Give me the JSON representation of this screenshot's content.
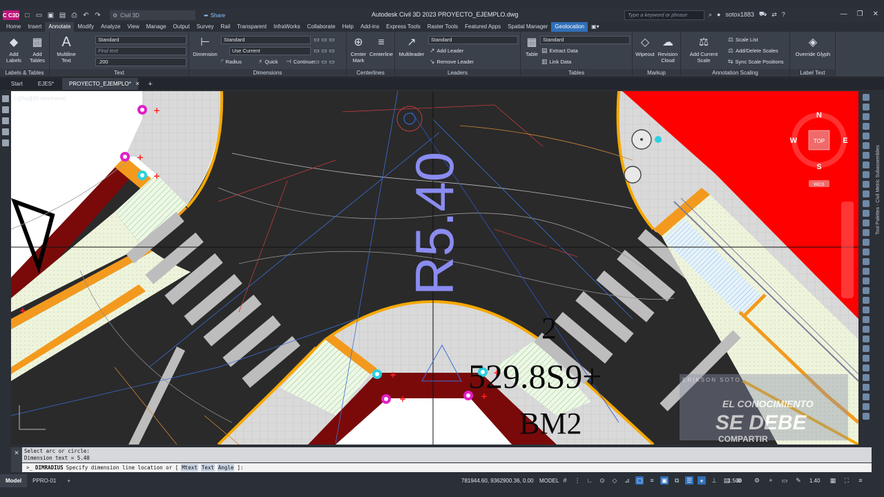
{
  "window": {
    "app_badge": "C C3D",
    "workspace": "Civil 3D",
    "share": "Share",
    "title": "Autodesk Civil 3D 2023   PROYECTO_EJEMPLO.dwg",
    "search_placeholder": "Type a keyword or phrase",
    "user": "sotox1883"
  },
  "ribbon_tabs": [
    "Home",
    "Insert",
    "Annotate",
    "Modify",
    "Analyze",
    "View",
    "Manage",
    "Output",
    "Survey",
    "Rail",
    "Transparent",
    "InfraWorks",
    "Collaborate",
    "Help",
    "Add-ins",
    "Express Tools",
    "Raster Tools",
    "Featured Apps",
    "Spatial Manager",
    "Geolocation"
  ],
  "active_tab": "Annotate",
  "ribbon": {
    "labels_tables": {
      "title": "Labels & Tables",
      "add_labels": "Add Labels",
      "add_tables": "Add Tables"
    },
    "text": {
      "title": "Text",
      "multiline": "Multiline Text",
      "style": "Standard",
      "find_placeholder": "Find text",
      "height": ".200"
    },
    "dimensions": {
      "title": "Dimensions",
      "dimension": "Dimension",
      "style": "Standard",
      "layer": "Use Current",
      "radius": "Radius",
      "quick": "Quick",
      "continue": "Continue"
    },
    "centerlines": {
      "title": "Centerlines",
      "center_mark": "Center Mark",
      "centerline": "Centerline"
    },
    "leaders": {
      "title": "Leaders",
      "multileader": "Multileader",
      "style": "Standard",
      "add_leader": "Add Leader",
      "remove_leader": "Remove Leader"
    },
    "tables": {
      "title": "Tables",
      "table": "Table",
      "style": "Standard",
      "extract_data": "Extract Data",
      "link_data": "Link Data"
    },
    "markup": {
      "title": "Markup",
      "wipeout": "Wipeout",
      "revision_cloud": "Revision Cloud"
    },
    "annotation_scaling": {
      "title": "Annotation Scaling",
      "add_current_scale": "Add Current Scale",
      "scale_list": "Scale List",
      "add_delete_scales": "Add/Delete Scales",
      "sync_scale_positions": "Sync Scale Positions"
    },
    "label_text": {
      "title": "Label Text",
      "override_glyph": "Override Glyph"
    }
  },
  "file_tabs": [
    "Start",
    "EJES*",
    "PROYECTO_EJEMPLO*"
  ],
  "active_file_tab": "PROYECTO_EJEMPLO*",
  "viewport": {
    "label": "[−][Top][2D Wireframe]",
    "dim_text": "R5.40",
    "num_text": "2",
    "station_text": "529.8S9+",
    "bm_text": "BM2",
    "viewcube": {
      "n": "N",
      "s": "S",
      "e": "E",
      "w": "W",
      "top": "TOP",
      "wcs": "WCS"
    },
    "watermark": {
      "author": "ERIKSON SOTO",
      "line1": "EL CONOCIMIENTO",
      "line2": "SE DEBE",
      "line3": "COMPARTIR"
    }
  },
  "palette_text": "Tool Palettes - Civil Metric Subassemblies",
  "command": {
    "history": [
      "Select arc or circle:",
      "Dimension text = 5.40"
    ],
    "command": "DIMRADIUS",
    "prompt": "Specify dimension line location or [",
    "options": [
      "Mtext",
      "Text",
      "Angle"
    ],
    "suffix": "]:"
  },
  "status": {
    "layout_tabs": [
      "Model",
      "PPRO-01"
    ],
    "active_layout": "Model",
    "coords": "781944.60, 9362900.36, 0.00",
    "mode": "MODEL",
    "scale": "1:500",
    "lineweight": "1.40"
  },
  "colors": {
    "accent": "#2f6fb8",
    "app": "#c0167a",
    "road": "#2a2a2b",
    "curb_orange": "#f39a1e",
    "maroon": "#7a0a0a",
    "dim_text": "#8a8cf0",
    "red_block": "#ff0000"
  }
}
